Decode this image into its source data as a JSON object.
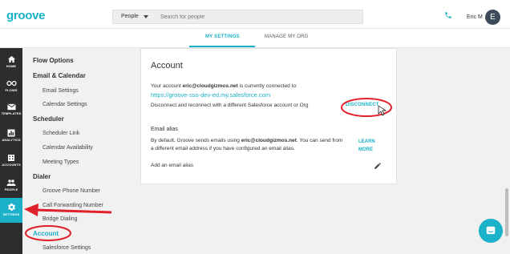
{
  "header": {
    "logo": "groove",
    "search_scope": "People",
    "search_placeholder": "Search for people",
    "user_name": "Eric M",
    "avatar_initial": "E"
  },
  "tabs": [
    {
      "label": "MY SETTINGS",
      "active": true
    },
    {
      "label": "MANAGE MY ORG",
      "active": false
    }
  ],
  "rail": [
    {
      "label": "HOME",
      "icon": "home-icon"
    },
    {
      "label": "FLOWS",
      "icon": "infinity-icon"
    },
    {
      "label": "TEMPLATES",
      "icon": "mail-icon"
    },
    {
      "label": "ANALYTICS",
      "icon": "chart-icon"
    },
    {
      "label": "ACCOUNTS",
      "icon": "building-icon"
    },
    {
      "label": "PEOPLE",
      "icon": "people-icon"
    },
    {
      "label": "SETTINGS",
      "icon": "gear-icon",
      "active": true
    }
  ],
  "sidebar": {
    "flow_options": "Flow Options",
    "email_calendar": "Email & Calendar",
    "email_settings": "Email Settings",
    "calendar_settings": "Calendar Settings",
    "scheduler": "Scheduler",
    "scheduler_link": "Scheduler Link",
    "calendar_availability": "Calendar Availability",
    "meeting_types": "Meeting Types",
    "dialer": "Dialer",
    "groove_phone_number": "Groove Phone Number",
    "call_forwarding_number": "Call Forwarding Number",
    "bridge_dialing": "Bridge Dialing",
    "account": "Account",
    "salesforce_settings": "Salesforce Settings"
  },
  "card": {
    "title": "Account",
    "connected_prefix": "Your account ",
    "connected_email": "eric@cloudgizmos.net",
    "connected_suffix": " is currently connected to:",
    "salesforce_url": "https://groove-sso-dev-ed.my.salesforce.com",
    "disconnect_text": "Disconnect and reconnect with a different Salesforce account or Org",
    "disconnect_label": "DISCONNECT",
    "email_alias_heading": "Email alias",
    "alias_line1_prefix": "By default, Groove sends emails using ",
    "alias_email": "eric@cloudgizmos.net",
    "alias_line1_suffix": ". You can send from",
    "alias_line2": "a different email address if you have configured an email alias.",
    "learn_more": "LEARN MORE",
    "add_alias": "Add an email alias"
  },
  "colors": {
    "accent": "#1ab1c9",
    "rail_bg": "#2d2d2d",
    "annotation_red": "#e0202a"
  }
}
